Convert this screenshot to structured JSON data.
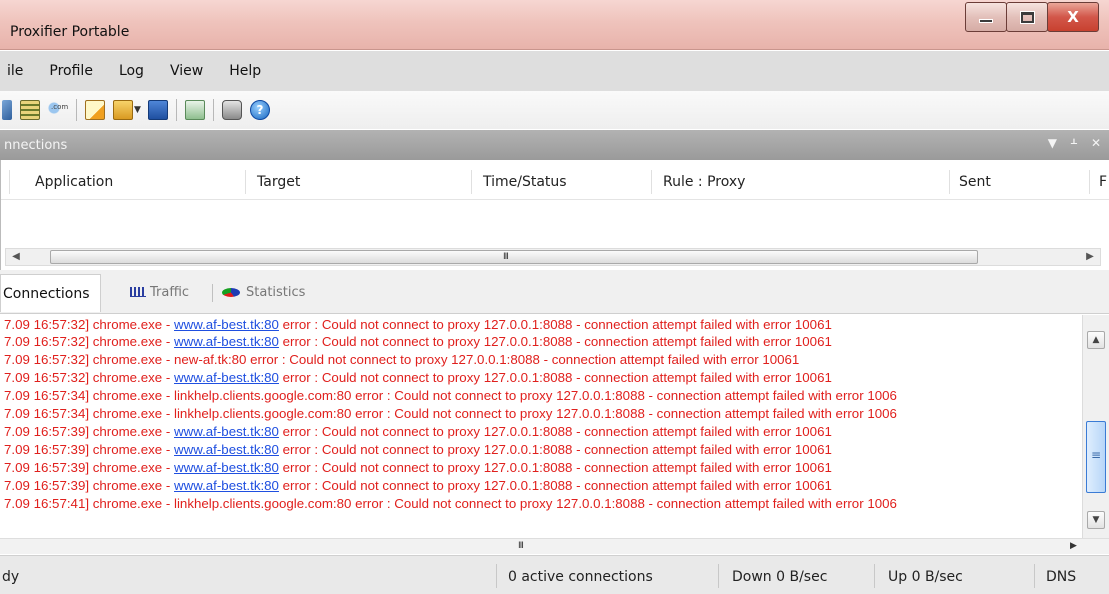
{
  "window": {
    "title": "Proxifier Portable",
    "close_glyph": "X"
  },
  "menu": [
    "ile",
    "Profile",
    "Log",
    "View",
    "Help"
  ],
  "toolbar": {
    "icons": [
      "profile-icon",
      "rules-icon",
      "domain-icon",
      "new-profile-icon",
      "open-profile-icon",
      "save-profile-icon",
      "proxy-servers-icon",
      "print-icon",
      "help-icon"
    ],
    "help_glyph": "?"
  },
  "panel": {
    "title": "nnections",
    "controls": [
      "▼",
      "ᚆ",
      "✕"
    ]
  },
  "table": {
    "columns": [
      "Application",
      "Target",
      "Time/Status",
      "Rule : Proxy",
      "Sent",
      "F"
    ],
    "scroll_grip": "III"
  },
  "tabs": [
    {
      "label": "Connections",
      "active": true
    },
    {
      "label": "Traffic",
      "active": false
    },
    {
      "label": "Statistics",
      "active": false
    }
  ],
  "log": {
    "lines": [
      {
        "pre": "7.09 16:57:32] chrome.exe - ",
        "link": "www.af-best.tk:80",
        "post": " error : Could not connect to proxy 127.0.0.1:8088 - connection attempt failed with error 10061"
      },
      {
        "pre": "7.09 16:57:32] chrome.exe - ",
        "link": "www.af-best.tk:80",
        "post": " error : Could not connect to proxy 127.0.0.1:8088 - connection attempt failed with error 10061"
      },
      {
        "pre": "7.09 16:57:32] chrome.exe - new-af.tk:80 error : Could not connect to proxy 127.0.0.1:8088 - connection attempt failed with error 10061",
        "link": "",
        "post": ""
      },
      {
        "pre": "7.09 16:57:32] chrome.exe - ",
        "link": "www.af-best.tk:80",
        "post": " error : Could not connect to proxy 127.0.0.1:8088 - connection attempt failed with error 10061"
      },
      {
        "pre": "7.09 16:57:34] chrome.exe - linkhelp.clients.google.com:80 error : Could not connect to proxy 127.0.0.1:8088 - connection attempt failed with error 1006",
        "link": "",
        "post": ""
      },
      {
        "pre": "7.09 16:57:34] chrome.exe - linkhelp.clients.google.com:80 error : Could not connect to proxy 127.0.0.1:8088 - connection attempt failed with error 1006",
        "link": "",
        "post": ""
      },
      {
        "pre": "7.09 16:57:39] chrome.exe - ",
        "link": "www.af-best.tk:80",
        "post": " error : Could not connect to proxy 127.0.0.1:8088 - connection attempt failed with error 10061"
      },
      {
        "pre": "7.09 16:57:39] chrome.exe - ",
        "link": "www.af-best.tk:80",
        "post": " error : Could not connect to proxy 127.0.0.1:8088 - connection attempt failed with error 10061"
      },
      {
        "pre": "7.09 16:57:39] chrome.exe - ",
        "link": "www.af-best.tk:80",
        "post": " error : Could not connect to proxy 127.0.0.1:8088 - connection attempt failed with error 10061"
      },
      {
        "pre": "7.09 16:57:39] chrome.exe - ",
        "link": "www.af-best.tk:80",
        "post": " error : Could not connect to proxy 127.0.0.1:8088 - connection attempt failed with error 10061"
      },
      {
        "pre": "7.09 16:57:41] chrome.exe - linkhelp.clients.google.com:80 error : Could not connect to proxy 127.0.0.1:8088 - connection attempt failed with error 1006",
        "link": "",
        "post": ""
      }
    ],
    "scroll_up": "▲",
    "scroll_down": "▼",
    "scroll_grip": "III"
  },
  "status": {
    "ready": "dy",
    "active_connections": "0 active connections",
    "down": "Down 0 B/sec",
    "up": "Up 0 B/sec",
    "dns": "DNS"
  },
  "colors": {
    "log_error": "#e0201d",
    "log_link": "#1f4fe0",
    "titlebar": "#efc3bc",
    "panel_header": "#a6a6a6"
  }
}
